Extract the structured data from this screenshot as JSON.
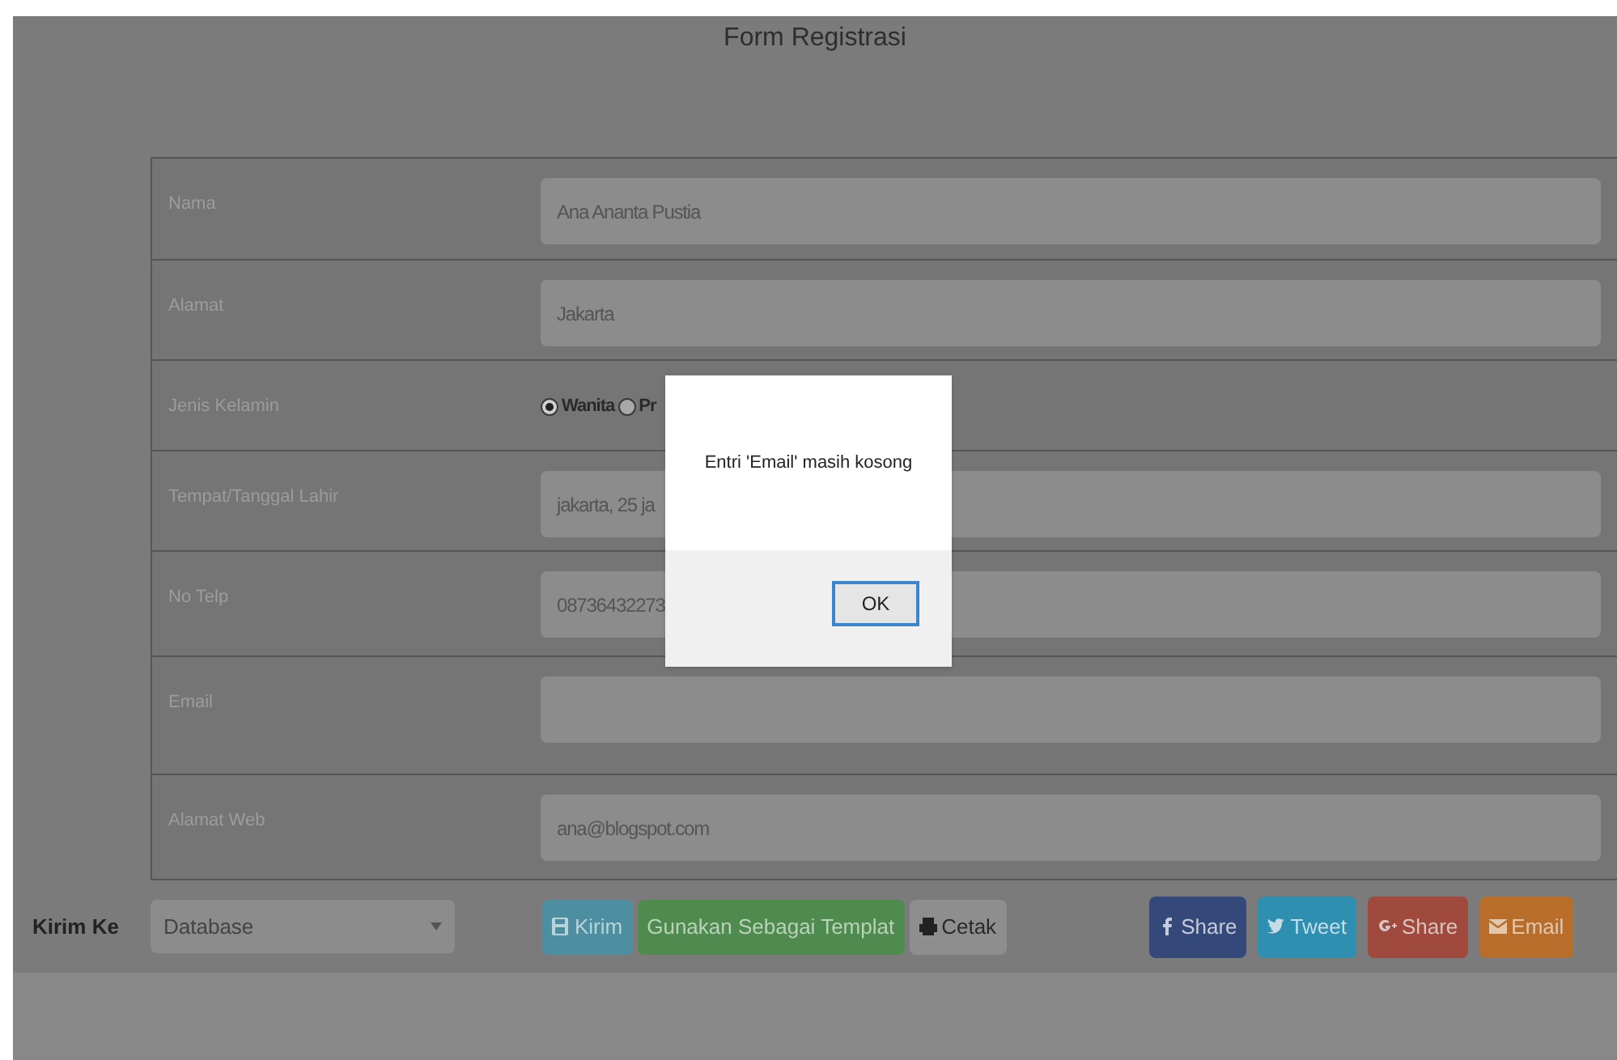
{
  "page_title": "Form Registrasi",
  "fields": [
    {
      "label": "Nama",
      "kind": "text",
      "value": "Ana Ananta Pustia"
    },
    {
      "label": "Alamat",
      "kind": "text",
      "value": "Jakarta"
    },
    {
      "label": "Jenis Kelamin",
      "kind": "radio",
      "options": [
        {
          "label": "Wanita",
          "selected": true
        },
        {
          "label": "Pr",
          "selected": false
        }
      ]
    },
    {
      "label": "Tempat/Tanggal Lahir",
      "kind": "text",
      "value": "jakarta, 25 ja"
    },
    {
      "label": "No Telp",
      "kind": "text",
      "value": "08736432273"
    },
    {
      "label": "Email",
      "kind": "text"
    },
    {
      "label": "Alamat Web",
      "kind": "text",
      "value": "ana@blogspot.com"
    }
  ],
  "send_to": {
    "label": "Kirim Ke",
    "select": "Database"
  },
  "actions": [
    {
      "label": "Kirim",
      "kind": "save",
      "color": "#4d8fa0"
    },
    {
      "label": "Gunakan Sebagai Templat",
      "kind": "plain",
      "color": "#4f8a4f"
    },
    {
      "label": "Cetak",
      "kind": "print",
      "color": "#8e8e8e"
    }
  ],
  "share_buttons": [
    {
      "label": "Share",
      "kind": "facebook",
      "color": "#34487a"
    },
    {
      "label": "Tweet",
      "kind": "twitter",
      "color": "#2f8fb0"
    },
    {
      "label": "Share",
      "kind": "google",
      "color": "#a04a3e"
    },
    {
      "label": "Email",
      "kind": "email",
      "color": "#b86e2a"
    }
  ],
  "dialog": {
    "message": "Entri 'Email' masih kosong",
    "button": "OK"
  }
}
